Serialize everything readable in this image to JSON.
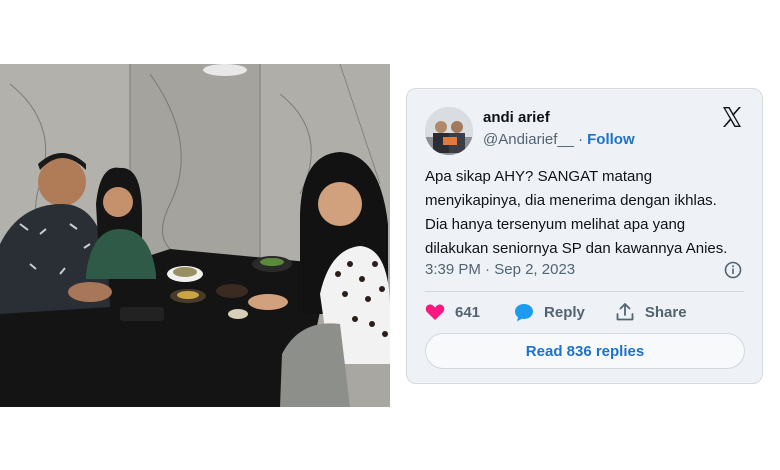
{
  "tweet": {
    "display_name": "andi arief",
    "handle": "@Andiarief__",
    "separator": "·",
    "follow_label": "Follow",
    "text": "Apa sikap AHY? SANGAT matang\nmenyikapinya, dia menerima dengan ikhlas.\nDia hanya tersenyum melihat apa yang\ndilakukan seniornya SP dan kawannya Anies.",
    "time": "3:39 PM",
    "date": "Sep 2, 2023",
    "like_count": "641",
    "reply_label": "Reply",
    "share_label": "Share",
    "read_replies_label": "Read 836 replies",
    "icons": {
      "like": "heart-icon",
      "reply": "speech-bubble-icon",
      "share": "share-upload-icon",
      "info": "info-icon",
      "brand": "x-logo-icon"
    },
    "colors": {
      "like": "#f91880",
      "reply": "#1d9bf0",
      "link": "#1d73c9"
    }
  }
}
